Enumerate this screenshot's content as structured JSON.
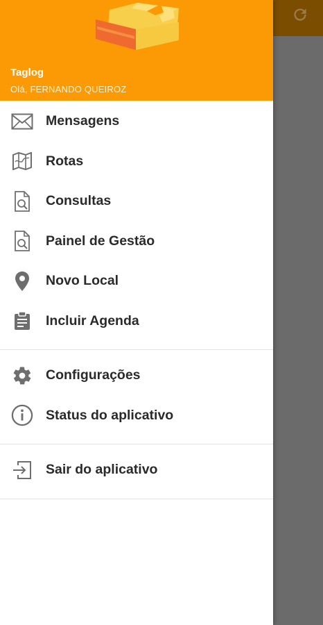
{
  "header": {
    "app_name": "Taglog",
    "greeting": "Olá, FERNANDO QUEIROZ"
  },
  "colors": {
    "header_bg": "#fb9a05",
    "toolbar_bg": "#7a4d00",
    "overlay_bg": "#6b6b6b",
    "icon_gray": "#6e6e6e"
  },
  "menu": {
    "main": [
      {
        "label": "Mensagens",
        "icon": "envelope-icon"
      },
      {
        "label": "Rotas",
        "icon": "map-icon"
      },
      {
        "label": "Consultas",
        "icon": "document-search-icon"
      },
      {
        "label": "Painel de Gestão",
        "icon": "document-search-icon"
      },
      {
        "label": "Novo Local",
        "icon": "location-pin-icon"
      },
      {
        "label": "Incluir Agenda",
        "icon": "clipboard-icon"
      }
    ],
    "settings": [
      {
        "label": "Configurações",
        "icon": "gear-icon"
      },
      {
        "label": "Status do aplicativo",
        "icon": "info-icon"
      }
    ],
    "exit": [
      {
        "label": "Sair do aplicativo",
        "icon": "exit-icon"
      }
    ]
  }
}
